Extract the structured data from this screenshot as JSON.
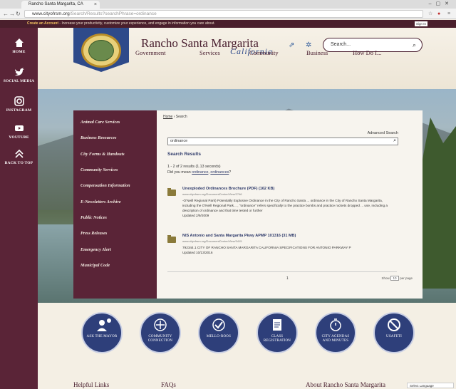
{
  "browser": {
    "tab_title": "Rancho Santa Margarita, CA",
    "url": "www.cityofrsm.org/Search/Results?searchPhrase=ordinance",
    "url_domain": "www.cityofrsm.org",
    "url_path": "/Search/Results?searchPhrase=ordinance"
  },
  "promo": {
    "bold": "Create an Account",
    "text": " - Increase your productivity, customize your experience, and engage in information you care about.",
    "signin": "Sign In"
  },
  "sidebar": {
    "items": [
      {
        "label": "HOME",
        "icon": "home-icon"
      },
      {
        "label": "SOCIAL MEDIA",
        "icon": "twitter-icon"
      },
      {
        "label": "INSTAGRAM",
        "icon": "instagram-icon"
      },
      {
        "label": "YOUTUBE",
        "icon": "youtube-icon"
      },
      {
        "label": "BACK TO TOP",
        "icon": "chevron-up-icon"
      }
    ]
  },
  "header": {
    "title": "Rancho Santa Margarita",
    "subtitle": "California",
    "search_placeholder": "Search..."
  },
  "nav": [
    "Government",
    "Services",
    "Community",
    "Business",
    "How Do I..."
  ],
  "leftnav": [
    "Animal Care Services",
    "Business Resources",
    "City Forms & Handouts",
    "Community Services",
    "Compensation Information",
    "E-Newsletters Archive",
    "Public Notices",
    "Press Releases",
    "Emergency Alert",
    "Municipal Code"
  ],
  "content": {
    "crumb_home": "Home",
    "crumb_sep": " › ",
    "crumb_current": "Search",
    "advanced": "Advanced Search",
    "query": "ordinance",
    "results_title": "Search Results",
    "count": "1 - 2 of 2 results (1.13 seconds)",
    "mean_prefix": "Did you mean ",
    "mean_a": "ordinance",
    "mean_sep": ", ",
    "mean_b": "ordinances",
    "mean_suffix": "?",
    "results": [
      {
        "title": "Unexploded Ordinances Brochure (PDF) (162 KB)",
        "url": "www.cityofrsm.org/DocumentCenter/View/2746",
        "desc": "-O'Neill Regional Park) Potentially Explosive Ordinance in the City of Rancho Santa ... ordinance in the City of Rancho Santa Margarita, including the O'Neill Regional Park... , \"ordinance\" refers specifically to the practice bombs and practice rockets dropped ... use, including a description of ordinance and that time tested or further",
        "date": "Updated 2/9/2009"
      },
      {
        "title": "NIS Antonio and Santa Margarita Pkwy APMP 101316 (31 MB)",
        "url": "www.cityofrsm.org/DocumentCenter/View/3415",
        "desc": "792344.1 CITY OF RANCHO SANTA MARGARITA CALIFORNIA SPECIFICATIONS FOR ANTONIO PARKWAY P",
        "date": "Updated 10/13/2016"
      }
    ],
    "page": "1",
    "per_page_label": "Show",
    "per_page": "10",
    "per_page_suffix": "per page"
  },
  "quicklinks": [
    {
      "label": "ASK THE MAYOR",
      "icon": "user-speech-icon"
    },
    {
      "label": "COMMUNITY CONNECTION",
      "icon": "connection-icon"
    },
    {
      "label": "MELLO-ROOS",
      "icon": "checkmark-icon"
    },
    {
      "label": "CLASS REGISTRATION",
      "icon": "document-icon"
    },
    {
      "label": "CITY AGENDAS AND MINUTES",
      "icon": "stopwatch-icon"
    },
    {
      "label": "USAFETI",
      "icon": "no-icon"
    }
  ],
  "footer": {
    "helpful": "Helpful Links",
    "faqs": "FAQs",
    "about": "About Rancho Santa Margarita",
    "translate": "Select Language"
  }
}
